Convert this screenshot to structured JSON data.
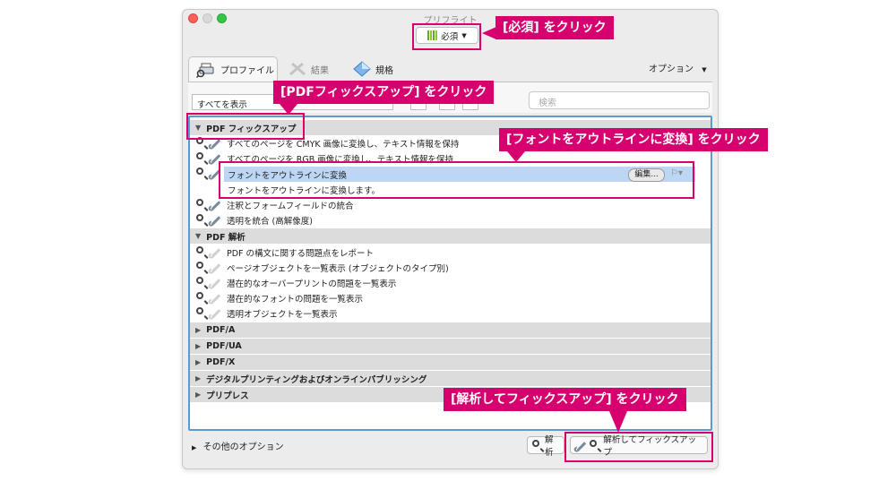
{
  "window": {
    "title": "プリフライト"
  },
  "profile": {
    "label": "必須"
  },
  "tabs": {
    "profile": "プロファイル",
    "results": "結果",
    "standards": "規格"
  },
  "options": {
    "label": "オプション"
  },
  "filter": {
    "select_all": "すべてを表示",
    "search_placeholder": "検索"
  },
  "list": {
    "group_fix": "PDF フィックスアップ",
    "fix1": "すべてのページを CMYK 画像に変換し、テキスト情報を保持",
    "fix2": "すべてのページを RGB 画像に変換し、テキスト情報を保持",
    "fix3": "フォントをアウトラインに変換",
    "fix3_desc": "フォントをアウトラインに変換します。",
    "fix3_edit": "編集...",
    "fix4": "注釈とフォームフィールドの統合",
    "fix5": "透明を統合 (高解像度)",
    "group_analysis": "PDF 解析",
    "an1": "PDF の構文に関する問題点をレポート",
    "an2": "ページオブジェクトを一覧表示 (オブジェクトのタイプ別)",
    "an3": "潜在的なオーバープリントの問題を一覧表示",
    "an4": "潜在的なフォントの問題を一覧表示",
    "an5": "透明オブジェクトを一覧表示",
    "g_pdfa": "PDF/A",
    "g_pdfua": "PDF/UA",
    "g_pdfx": "PDF/X",
    "g_digital": "デジタルプリンティングおよびオンラインパブリッシング",
    "g_prepress": "プリプレス"
  },
  "bottom": {
    "more_options": "その他のオプション",
    "analyze": "解析",
    "analyze_fix": "解析してフィックスアップ"
  },
  "callouts": {
    "c1": "[必須] をクリック",
    "c2": "[PDFフィックスアップ] をクリック",
    "c3": "[フォントをアウトラインに変換] をクリック",
    "c4": "[解析してフィックスアップ] をクリック"
  },
  "colors": {
    "accent": "#d6006e",
    "selection": "#bcd6f4",
    "list_border": "#5b9bd5"
  }
}
